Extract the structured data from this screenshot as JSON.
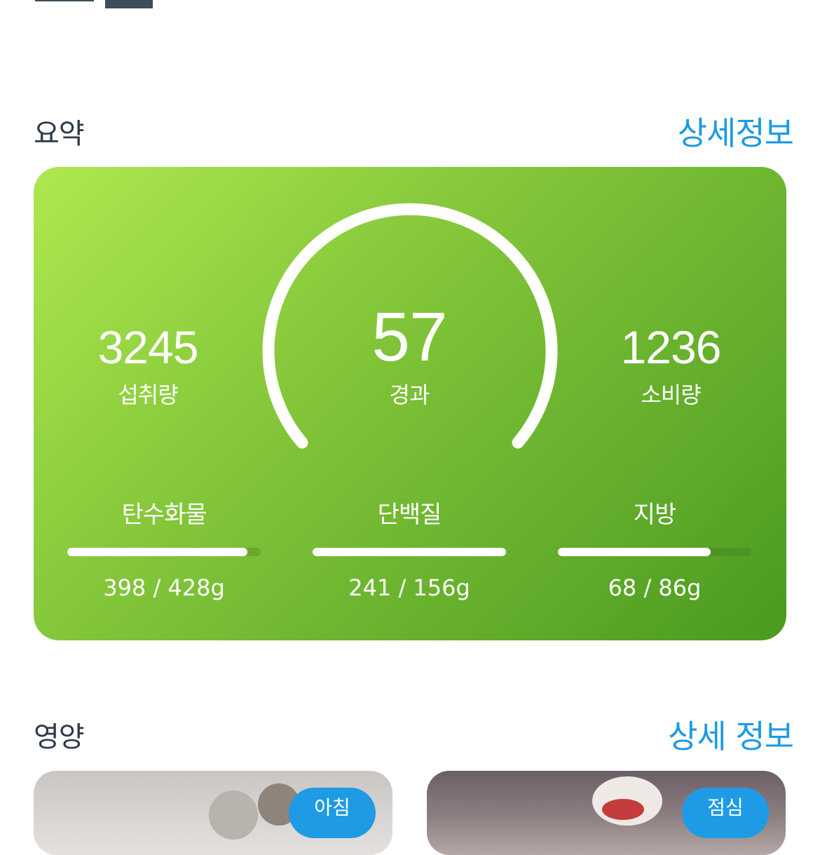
{
  "summary": {
    "title": "요약",
    "detail_link": "상세정보",
    "intake": {
      "value": "3245",
      "label": "섭취량"
    },
    "progress": {
      "value": "57",
      "label": "경과"
    },
    "burned": {
      "value": "1236",
      "label": "소비량"
    },
    "macros": [
      {
        "label": "탄수화물",
        "value": "398 / 428g",
        "fraction": 0.93
      },
      {
        "label": "단백질",
        "value": "241 / 156g",
        "fraction": 1.0
      },
      {
        "label": "지방",
        "value": "68 / 86g",
        "fraction": 0.79
      }
    ]
  },
  "nutrition": {
    "title": "영양",
    "detail_link": "상세 정보",
    "meals": [
      {
        "tag": "아침"
      },
      {
        "tag": "점심"
      }
    ]
  },
  "colors": {
    "accent": "#1d9be0",
    "card_gradient_start": "#aee84f",
    "card_gradient_end": "#4a9a20",
    "text_dark": "#2c3a48"
  }
}
